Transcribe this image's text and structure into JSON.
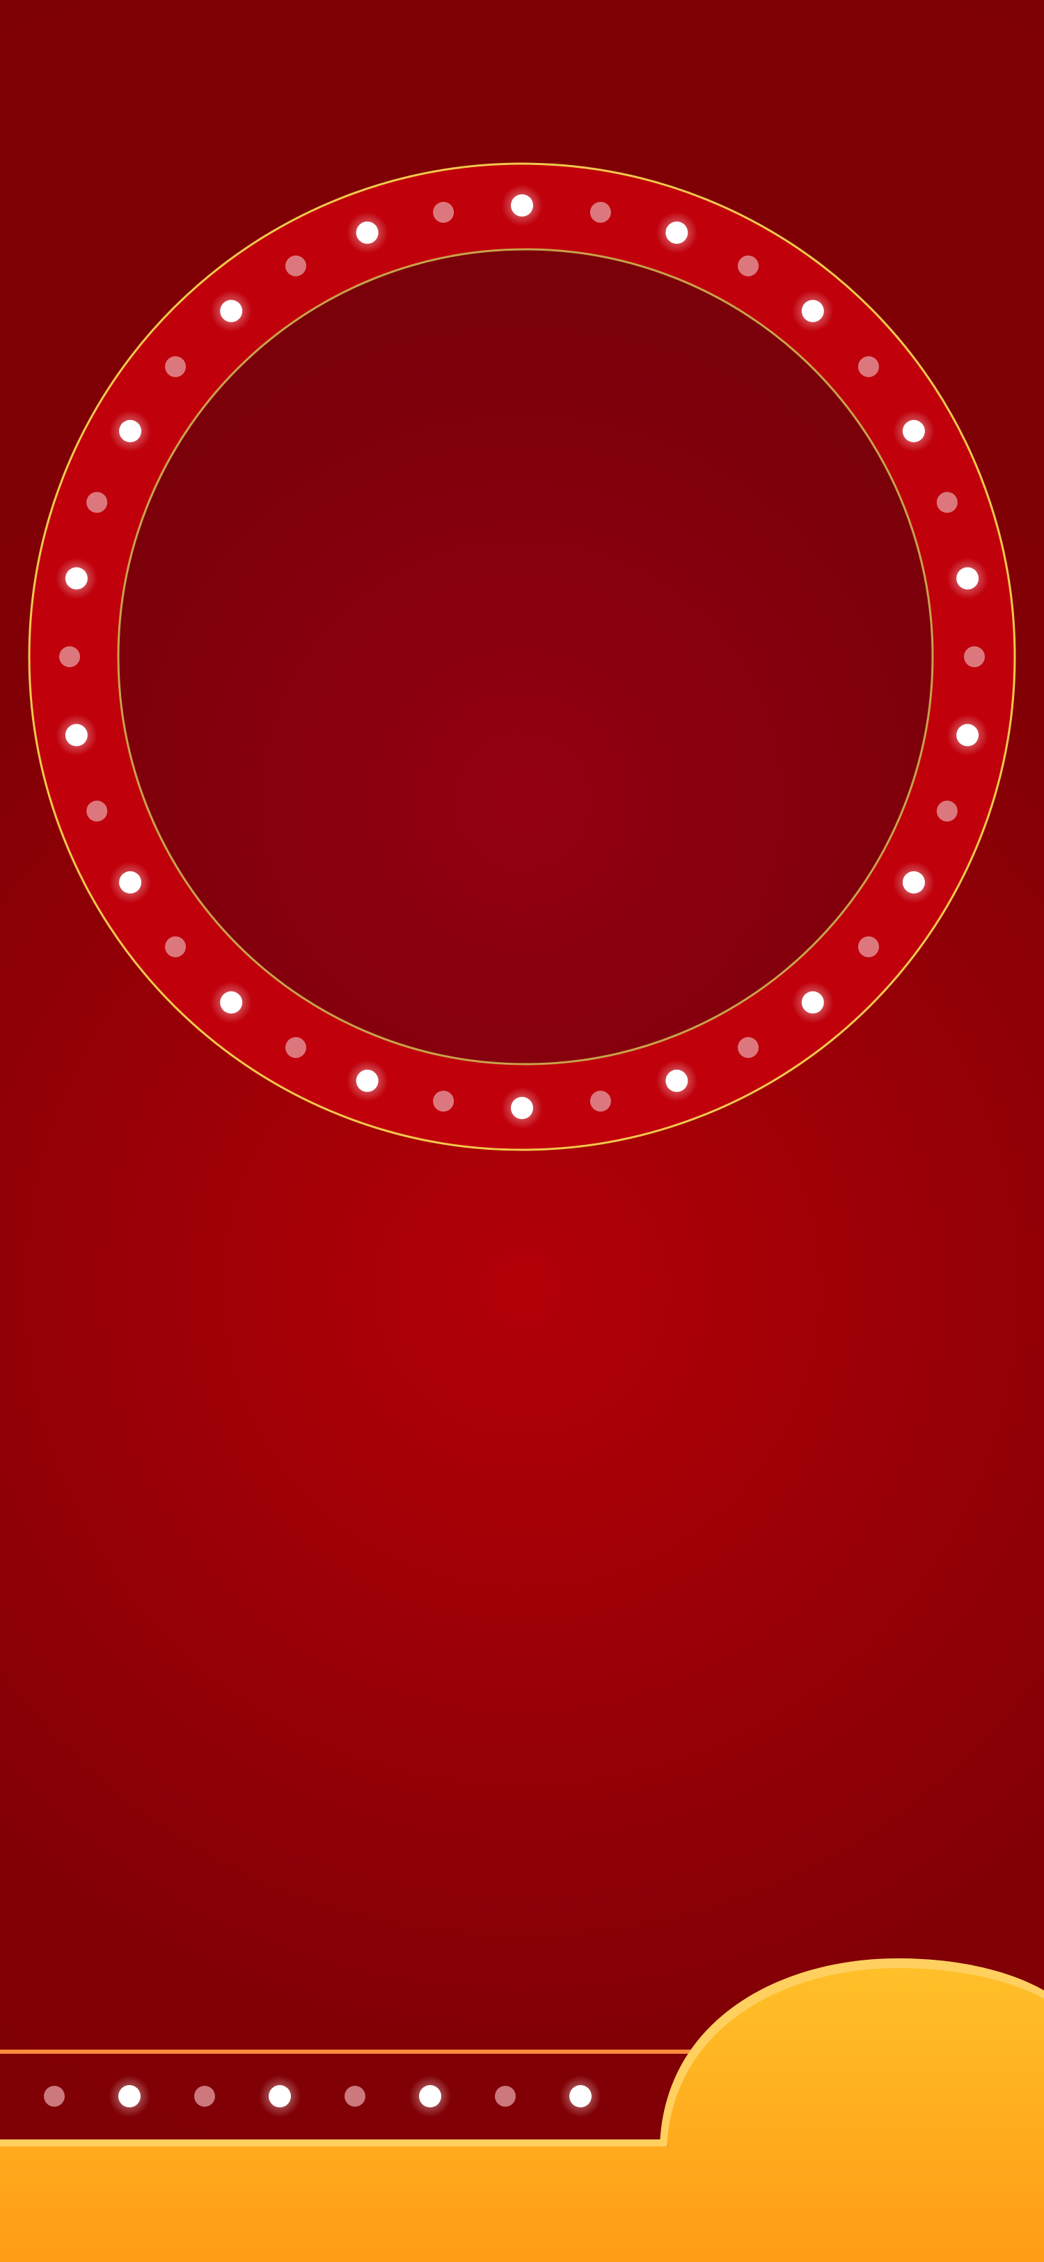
{
  "palette": {
    "background_top": "#800005",
    "background_glow": "#b30007",
    "background_bottom": "#7d0004",
    "wheel_ring": "#c0000b",
    "wheel_rim": "#f2c94c",
    "wheel_inner": "#7a000a",
    "wheel_inner_edge": "#c9a24a",
    "bulb_on": "#ffffff",
    "bulb_off": "#e6a0a4",
    "stage_base": "#ffad1a",
    "stage_base_bottom": "#ff9c16",
    "stage_line": "#ff8a3c"
  },
  "wheel": {
    "bulb_count": 36,
    "bulb_pattern": [
      "on",
      "off"
    ]
  },
  "stage_strip": {
    "bulb_count": 8,
    "bulb_pattern": [
      "off",
      "on"
    ]
  }
}
